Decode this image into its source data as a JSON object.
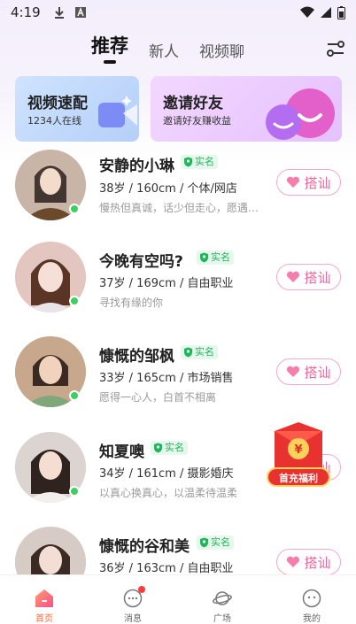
{
  "status_bar": {
    "time": "4:19"
  },
  "tabs": [
    {
      "label": "推荐",
      "active": true
    },
    {
      "label": "新人",
      "active": false
    },
    {
      "label": "视频聊",
      "active": false
    }
  ],
  "banners": {
    "left": {
      "title": "视频速配",
      "subtitle": "1234人在线"
    },
    "right": {
      "title": "邀请好友",
      "subtitle": "邀请好友赚收益"
    }
  },
  "users": [
    {
      "name": "安静的小琳",
      "verified": "实名",
      "info": "38岁 / 160cm / 个体/网店",
      "bio": "慢热但真诚，话少但走心，愿遇…",
      "button": "搭讪",
      "online": true
    },
    {
      "name": "今晚有空吗?",
      "verified": "实名",
      "info": "37岁 / 169cm / 自由职业",
      "bio": "寻找有缘的你",
      "button": "搭讪",
      "online": true
    },
    {
      "name": "慷慨的邹枫",
      "verified": "实名",
      "info": "33岁 / 165cm / 市场销售",
      "bio": "愿得一心人，白首不相离",
      "button": "搭讪",
      "online": true
    },
    {
      "name": "知夏噢",
      "verified": "实名",
      "info": "34岁 / 161cm / 摄影婚庆",
      "bio": "以真心换真心，以温柔待温柔",
      "button": "搭讪",
      "online": true
    },
    {
      "name": "慷慨的谷和美",
      "verified": "实名",
      "info": "36岁 / 163cm / 自由职业",
      "bio": "",
      "button": "搭讪",
      "online": false
    }
  ],
  "float_reward": {
    "label": "首充福利"
  },
  "bottom_nav": [
    {
      "label": "首页",
      "icon": "home-icon",
      "active": true
    },
    {
      "label": "消息",
      "icon": "message-icon",
      "active": false,
      "badge": true
    },
    {
      "label": "广场",
      "icon": "planet-icon",
      "active": false
    },
    {
      "label": "我的",
      "icon": "profile-icon",
      "active": false
    }
  ],
  "colors": {
    "accent_pink": "#f0639a",
    "verified_green": "#22b45c",
    "online_green": "#3ccf62",
    "nav_active": "#ff6a3d"
  }
}
